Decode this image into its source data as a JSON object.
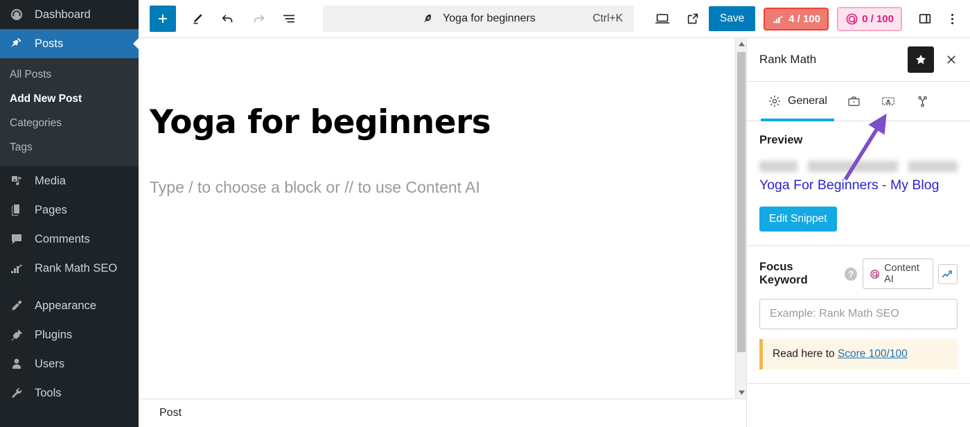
{
  "sidebar": {
    "items": [
      {
        "label": "Dashboard",
        "icon": "dashboard-icon",
        "active": false
      },
      {
        "label": "Posts",
        "icon": "pin-icon",
        "active": true
      },
      {
        "label": "Media",
        "icon": "media-icon",
        "active": false
      },
      {
        "label": "Pages",
        "icon": "pages-icon",
        "active": false
      },
      {
        "label": "Comments",
        "icon": "comments-icon",
        "active": false
      },
      {
        "label": "Rank Math SEO",
        "icon": "rank-math-icon",
        "active": false
      },
      {
        "label": "Appearance",
        "icon": "appearance-icon",
        "active": false
      },
      {
        "label": "Plugins",
        "icon": "plugins-icon",
        "active": false
      },
      {
        "label": "Users",
        "icon": "users-icon",
        "active": false
      },
      {
        "label": "Tools",
        "icon": "tools-icon",
        "active": false
      }
    ],
    "submenu": [
      {
        "label": "All Posts",
        "current": false
      },
      {
        "label": "Add New Post",
        "current": true
      },
      {
        "label": "Categories",
        "current": false
      },
      {
        "label": "Tags",
        "current": false
      }
    ]
  },
  "toolbar": {
    "add_block_label": "+",
    "document_title": "Yoga for beginners",
    "command_shortcut": "Ctrl+K",
    "save_label": "Save",
    "seo_score": "4 / 100",
    "content_ai_score": "0 / 100",
    "icons": {
      "add": "plus-icon",
      "tools": "pencil-icon",
      "undo": "undo-icon",
      "redo": "redo-icon",
      "list_view": "list-view-icon",
      "feather": "feather-icon",
      "view": "desktop-icon",
      "preview": "external-link-icon",
      "settings_panel": "sidebar-toggle-icon",
      "options": "kebab-menu-icon"
    }
  },
  "editor": {
    "post_title": "Yoga for beginners",
    "body_placeholder": "Type / to choose a block or // to use Content AI",
    "status_bar": "Post"
  },
  "rank_math": {
    "panel_title": "Rank Math",
    "tabs": [
      {
        "label": "General",
        "icon": "gear-icon",
        "active": true
      },
      {
        "label": "",
        "icon": "briefcase-icon",
        "active": false
      },
      {
        "label": "",
        "icon": "schema-icon",
        "active": false
      },
      {
        "label": "",
        "icon": "social-share-icon",
        "active": false
      }
    ],
    "preview": {
      "heading": "Preview",
      "url": "",
      "title": "Yoga For Beginners - My Blog",
      "edit_snippet_label": "Edit Snippet"
    },
    "focus_keyword": {
      "label": "Focus Keyword",
      "help_glyph": "?",
      "content_ai_label": "Content AI",
      "trend_icon": "trend-up-icon",
      "input_placeholder": "Example: Rank Math SEO",
      "input_value": "",
      "notice_prefix": "Read here to ",
      "notice_link": "Score 100/100"
    },
    "star_icon": "star-icon",
    "close_icon": "close-icon"
  },
  "colors": {
    "wp_sidebar_bg": "#1d2327",
    "wp_active_blue": "#2271b1",
    "primary_blue": "#007cba",
    "rm_blue": "#13a9e2",
    "seo_red": "#ef4136",
    "content_ai_pink": "#e5197f",
    "annotation_purple": "#7b4fc9",
    "snippet_title_blue": "#2c23cf"
  },
  "annotation": {
    "type": "arrow",
    "color": "#7b4fc9",
    "points_to": "schema-tab-icon"
  }
}
